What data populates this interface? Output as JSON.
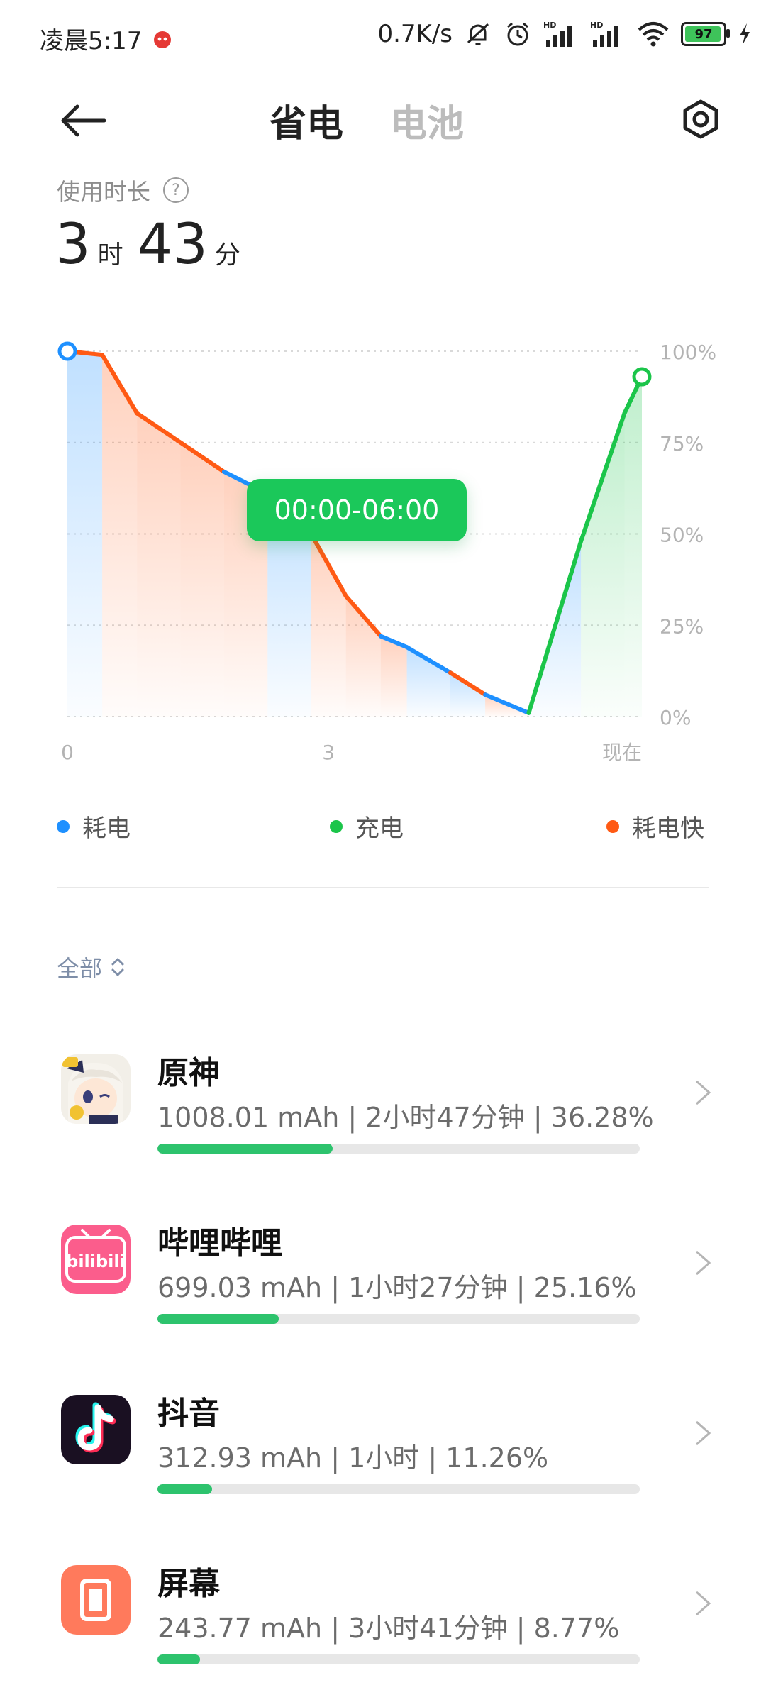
{
  "status": {
    "time": "凌晨5:17",
    "net_speed": "0.7K/s",
    "battery": "97"
  },
  "header": {
    "tabs": [
      {
        "label": "省电",
        "active": true
      },
      {
        "label": "电池",
        "active": false
      }
    ]
  },
  "usage": {
    "label": "使用时长",
    "hours": "3",
    "hours_unit": "时",
    "minutes": "43",
    "minutes_unit": "分"
  },
  "chart_data": {
    "type": "line",
    "y_ticks": [
      "100%",
      "75%",
      "50%",
      "25%",
      "0%"
    ],
    "x_ticks": [
      "0",
      "3",
      "现在"
    ],
    "tooltip": "00:00-06:00",
    "series": [
      {
        "name": "耗电",
        "color": "#1e90ff"
      },
      {
        "name": "充电",
        "color": "#1bc54a"
      },
      {
        "name": "耗电快",
        "color": "#ff5a14"
      }
    ],
    "points": [
      {
        "x": 0.0,
        "y": 100,
        "status": "耗电"
      },
      {
        "x": 0.4,
        "y": 99,
        "status": "耗电快"
      },
      {
        "x": 0.8,
        "y": 83,
        "status": "耗电快"
      },
      {
        "x": 1.3,
        "y": 75,
        "status": "耗电快"
      },
      {
        "x": 1.8,
        "y": 67,
        "status": "耗电快"
      },
      {
        "x": 2.3,
        "y": 61,
        "status": "耗电"
      },
      {
        "x": 2.8,
        "y": 50,
        "status": "耗电快"
      },
      {
        "x": 3.2,
        "y": 33,
        "status": "耗电快"
      },
      {
        "x": 3.6,
        "y": 22,
        "status": "耗电快"
      },
      {
        "x": 3.9,
        "y": 19,
        "status": "耗电"
      },
      {
        "x": 4.4,
        "y": 12,
        "status": "耗电"
      },
      {
        "x": 4.8,
        "y": 6,
        "status": "耗电快"
      },
      {
        "x": 5.3,
        "y": 1,
        "status": "耗电"
      },
      {
        "x": 5.9,
        "y": 48,
        "status": "充电"
      },
      {
        "x": 6.4,
        "y": 83,
        "status": "充电"
      },
      {
        "x": 6.6,
        "y": 93,
        "status": "充电"
      }
    ],
    "x_range": [
      0,
      6.6
    ],
    "y_range": [
      0,
      100
    ],
    "grid": true
  },
  "legend": [
    {
      "label": "耗电",
      "color": "#1e90ff"
    },
    {
      "label": "充电",
      "color": "#1bc54a"
    },
    {
      "label": "耗电快",
      "color": "#ff5a14"
    }
  ],
  "filter": {
    "label": "全部"
  },
  "apps": [
    {
      "name": "原神",
      "meta": "1008.01 mAh | 2小时47分钟 | 36.28%",
      "percent": 36.28,
      "icon": "genshin-icon"
    },
    {
      "name": "哔哩哔哩",
      "meta": "699.03 mAh | 1小时27分钟 | 25.16%",
      "percent": 25.16,
      "icon": "bilibili-icon",
      "icon_text": "bilibili"
    },
    {
      "name": "抖音",
      "meta": "312.93 mAh | 1小时 | 11.26%",
      "percent": 11.26,
      "icon": "douyin-icon"
    },
    {
      "name": "屏幕",
      "meta": "243.77 mAh | 3小时41分钟 | 8.77%",
      "percent": 8.77,
      "icon": "screen-icon"
    }
  ]
}
